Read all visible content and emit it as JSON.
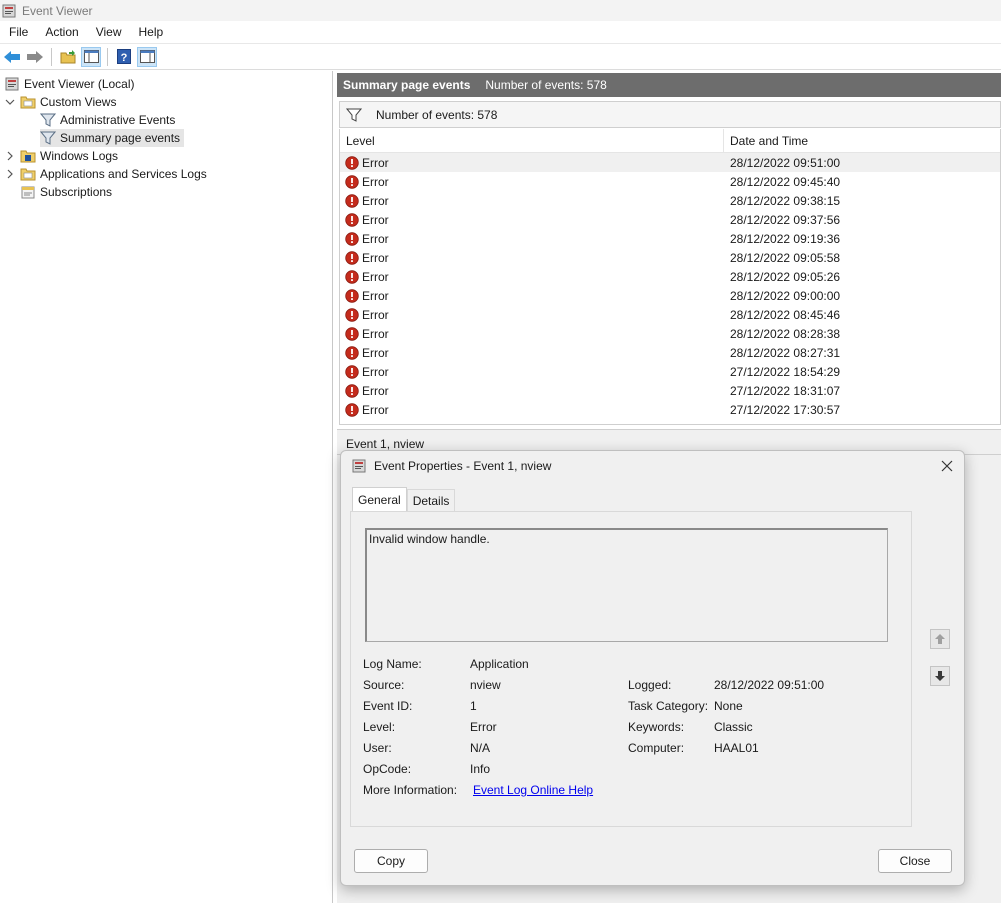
{
  "window": {
    "title": "Event Viewer"
  },
  "menu": [
    "File",
    "Action",
    "View",
    "Help"
  ],
  "toolbar": {
    "buttons": [
      "back-icon",
      "forward-icon",
      "open-folder-icon",
      "show-hide-console-tree-icon",
      "help-icon",
      "show-hide-action-pane-icon"
    ]
  },
  "tree": {
    "root": "Event Viewer (Local)",
    "custom_views": "Custom Views",
    "admin_events": "Administrative Events",
    "summary_events": "Summary page events",
    "windows_logs": "Windows Logs",
    "app_services_logs": "Applications and Services Logs",
    "subscriptions": "Subscriptions"
  },
  "panel": {
    "title": "Summary page events",
    "count": "Number of events: 578",
    "filter_text": "Number of events: 578",
    "col_level": "Level",
    "col_date": "Date and Time"
  },
  "rows": [
    {
      "level": "Error",
      "date": "28/12/2022 09:51:00"
    },
    {
      "level": "Error",
      "date": "28/12/2022 09:45:40"
    },
    {
      "level": "Error",
      "date": "28/12/2022 09:38:15"
    },
    {
      "level": "Error",
      "date": "28/12/2022 09:37:56"
    },
    {
      "level": "Error",
      "date": "28/12/2022 09:19:36"
    },
    {
      "level": "Error",
      "date": "28/12/2022 09:05:58"
    },
    {
      "level": "Error",
      "date": "28/12/2022 09:05:26"
    },
    {
      "level": "Error",
      "date": "28/12/2022 09:00:00"
    },
    {
      "level": "Error",
      "date": "28/12/2022 08:45:46"
    },
    {
      "level": "Error",
      "date": "28/12/2022 08:28:38"
    },
    {
      "level": "Error",
      "date": "28/12/2022 08:27:31"
    },
    {
      "level": "Error",
      "date": "27/12/2022 18:54:29"
    },
    {
      "level": "Error",
      "date": "27/12/2022 18:31:07"
    },
    {
      "level": "Error",
      "date": "27/12/2022 17:30:57"
    }
  ],
  "lower_pane": {
    "title": "Event 1, nview"
  },
  "dialog": {
    "title": "Event Properties - Event 1, nview",
    "tab_general": "General",
    "tab_details": "Details",
    "description": "Invalid window handle.",
    "labels": {
      "log_name": "Log Name:",
      "source": "Source:",
      "event_id": "Event ID:",
      "level": "Level:",
      "user": "User:",
      "opcode": "OpCode:",
      "more_info": "More Information:",
      "logged": "Logged:",
      "task_category": "Task Category:",
      "keywords": "Keywords:",
      "computer": "Computer:"
    },
    "values": {
      "log_name": "Application",
      "source": "nview",
      "event_id": "1",
      "level": "Error",
      "user": "N/A",
      "opcode": "Info",
      "more_info": "Event Log Online Help",
      "logged": "28/12/2022 09:51:00",
      "task_category": "None",
      "keywords": "Classic",
      "computer": "HAAL01"
    },
    "copy_label": "Copy",
    "close_label": "Close"
  }
}
